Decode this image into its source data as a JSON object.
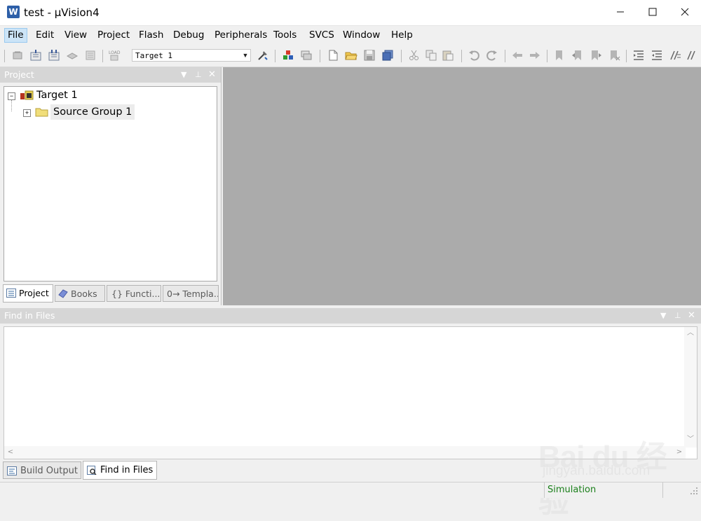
{
  "window": {
    "title": "test  - µVision4",
    "minimize_glyph": "—",
    "maximize_glyph": "☐",
    "close_glyph": "✕"
  },
  "menu": {
    "items": [
      "File",
      "Edit",
      "View",
      "Project",
      "Flash",
      "Debug",
      "Peripherals",
      "Tools",
      "SVCS",
      "Window",
      "Help"
    ],
    "active": "File"
  },
  "toolbar": {
    "target_select_value": "Target 1"
  },
  "project_panel": {
    "title": "Project",
    "tree": {
      "root_label": "Target 1",
      "child_label": "Source Group 1"
    },
    "tabs": [
      "Project",
      "Books",
      "{} Functi...",
      "0→ Templa..."
    ],
    "active_tab": "Project"
  },
  "find_panel": {
    "title": "Find in Files"
  },
  "bottom_tabs": {
    "items": [
      "Build Output",
      "Find in Files"
    ],
    "active": "Find in Files"
  },
  "statusbar": {
    "mode": "Simulation"
  },
  "watermark": {
    "brand": "Bai du 经验",
    "site": "jingyan.baidu.com"
  },
  "colors": {
    "panel_header": "#d6d6d6",
    "editor_bg": "#ababab",
    "status_green": "#1a7f1a",
    "menu_highlight": "#cce4f7"
  }
}
